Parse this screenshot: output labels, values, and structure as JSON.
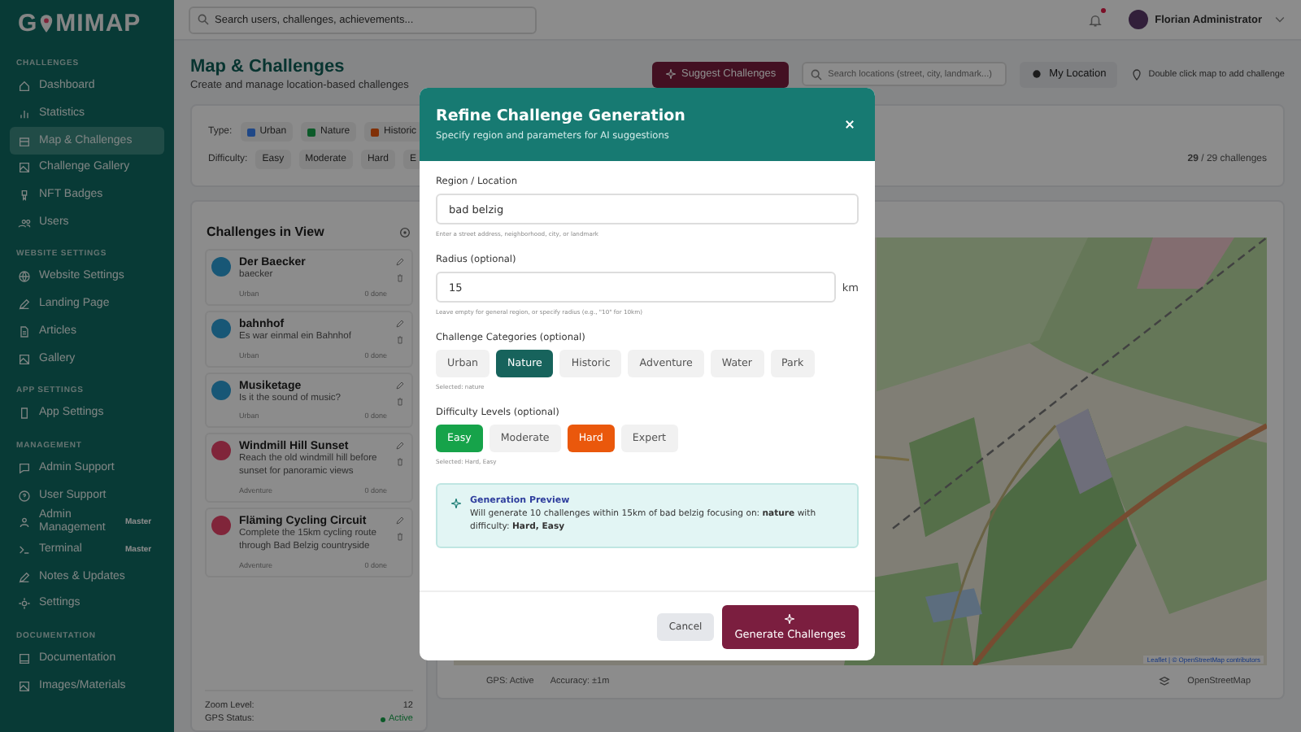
{
  "logo": {
    "before": "G",
    "after": "MIMAP"
  },
  "sidebar": {
    "sections": [
      {
        "title": "CHALLENGES",
        "items": [
          {
            "label": "Dashboard",
            "selected": false
          },
          {
            "label": "Statistics",
            "selected": false
          },
          {
            "label": "Map & Challenges",
            "selected": true
          },
          {
            "label": "Challenge Gallery",
            "selected": false
          },
          {
            "label": "NFT Badges",
            "selected": false
          },
          {
            "label": "Users",
            "selected": false
          }
        ]
      },
      {
        "title": "WEBSITE SETTINGS",
        "items": [
          {
            "label": "Website Settings",
            "selected": false
          },
          {
            "label": "Landing Page",
            "selected": false
          },
          {
            "label": "Articles",
            "selected": false
          },
          {
            "label": "Gallery",
            "selected": false
          }
        ]
      },
      {
        "title": "APP SETTINGS",
        "items": [
          {
            "label": "App Settings",
            "selected": false
          }
        ]
      },
      {
        "title": "MANAGEMENT",
        "items": [
          {
            "label": "Admin Support",
            "selected": false
          },
          {
            "label": "User Support",
            "selected": false
          },
          {
            "label": "Admin Management",
            "selected": false,
            "badge": "Master"
          },
          {
            "label": "Terminal",
            "selected": false,
            "badge": "Master"
          },
          {
            "label": "Notes & Updates",
            "selected": false
          },
          {
            "label": "Settings",
            "selected": false
          }
        ]
      },
      {
        "title": "DOCUMENTATION",
        "items": [
          {
            "label": "Documentation",
            "selected": false
          },
          {
            "label": "Images/Materials",
            "selected": false
          }
        ]
      }
    ]
  },
  "topbar": {
    "search": {
      "placeholder": "Search users, challenges, achievements..."
    },
    "notification": true,
    "user": "Florian Administrator"
  },
  "page": {
    "title": "Map & Challenges",
    "subtitle": "Create and manage location-based challenges"
  },
  "actions": {
    "suggest": "Suggest Challenges",
    "location_search": {
      "placeholder": "Search locations (street, city, landmark...)"
    },
    "my_location": "My Location",
    "hint": "Double click map to add challenge"
  },
  "filters": {
    "type_label": "Type:",
    "types": [
      {
        "label": "Urban",
        "color": "#204887"
      },
      {
        "label": "Nature",
        "color": "#0c5a29"
      },
      {
        "label": "Historic",
        "color": "#813007"
      }
    ],
    "difficulty_label": "Difficulty:",
    "difficulties": [
      "Easy",
      "Moderate",
      "Hard",
      "E"
    ],
    "count": "29",
    "total": "/ 29 challenges"
  },
  "list": {
    "title": "Challenges in View",
    "items": [
      {
        "name": "Der Baecker",
        "description": "baecker",
        "category": "Urban",
        "done": "0 done",
        "color": "#185776"
      },
      {
        "name": "bahnhof",
        "description": "Es war einmal ein Bahnhof",
        "category": "Urban",
        "done": "0 done",
        "color": "#185776"
      },
      {
        "name": "Musiketage",
        "description": "Is it the sound of music?",
        "category": "Urban",
        "done": "0 done",
        "color": "#185776"
      },
      {
        "name": "Windmill Hill Sunset",
        "description": "Reach the old windmill hill before sunset for panoramic views",
        "category": "Adventure",
        "done": "0 done",
        "color": "#80253a"
      },
      {
        "name": "Fläming Cycling Circuit",
        "description": "Complete the 15km cycling route through Bad Belzig countryside",
        "category": "Adventure",
        "done": "0 done",
        "color": "#80253a"
      }
    ],
    "zoom_label": "Zoom Level:",
    "zoom": "12",
    "gps_label": "GPS Status:",
    "gps": "Active"
  },
  "map": {
    "attribution": "Leaflet | © OpenStreetMap contributors",
    "gps": "GPS: Active",
    "accuracy": "Accuracy: ±1m",
    "provider": "OpenStreetMap"
  },
  "modal": {
    "title": "Refine Challenge Generation",
    "subtitle": "Specify region and parameters for AI suggestions",
    "region": {
      "label": "Region / Location",
      "value": "bad belzig",
      "hint": "Enter a street address, neighborhood, city, or landmark"
    },
    "radius": {
      "label": "Radius (optional)",
      "value": "15",
      "unit": "km",
      "hint": "Leave empty for general region, or specify radius (e.g., \"10\" for 10km)"
    },
    "categories": {
      "label": "Challenge Categories (optional)",
      "options": [
        {
          "label": "Urban",
          "selected": false
        },
        {
          "label": "Nature",
          "selected": true
        },
        {
          "label": "Historic",
          "selected": false
        },
        {
          "label": "Adventure",
          "selected": false
        },
        {
          "label": "Water",
          "selected": false
        },
        {
          "label": "Park",
          "selected": false
        }
      ],
      "summary": "Selected: nature"
    },
    "difficulty": {
      "label": "Difficulty Levels (optional)",
      "options": [
        {
          "label": "Easy",
          "selected": true,
          "color": "#16a34a"
        },
        {
          "label": "Moderate",
          "selected": false
        },
        {
          "label": "Hard",
          "selected": true,
          "color": "#ea580c"
        },
        {
          "label": "Expert",
          "selected": false
        }
      ],
      "summary": "Selected: Hard, Easy"
    },
    "preview": {
      "title": "Generation Preview",
      "text": "Will generate 10 challenges within 15km of bad belzig focusing on: **nature** with difficulty: **Hard, Easy**"
    },
    "cancel": "Cancel",
    "generate": "Generate Challenges"
  }
}
